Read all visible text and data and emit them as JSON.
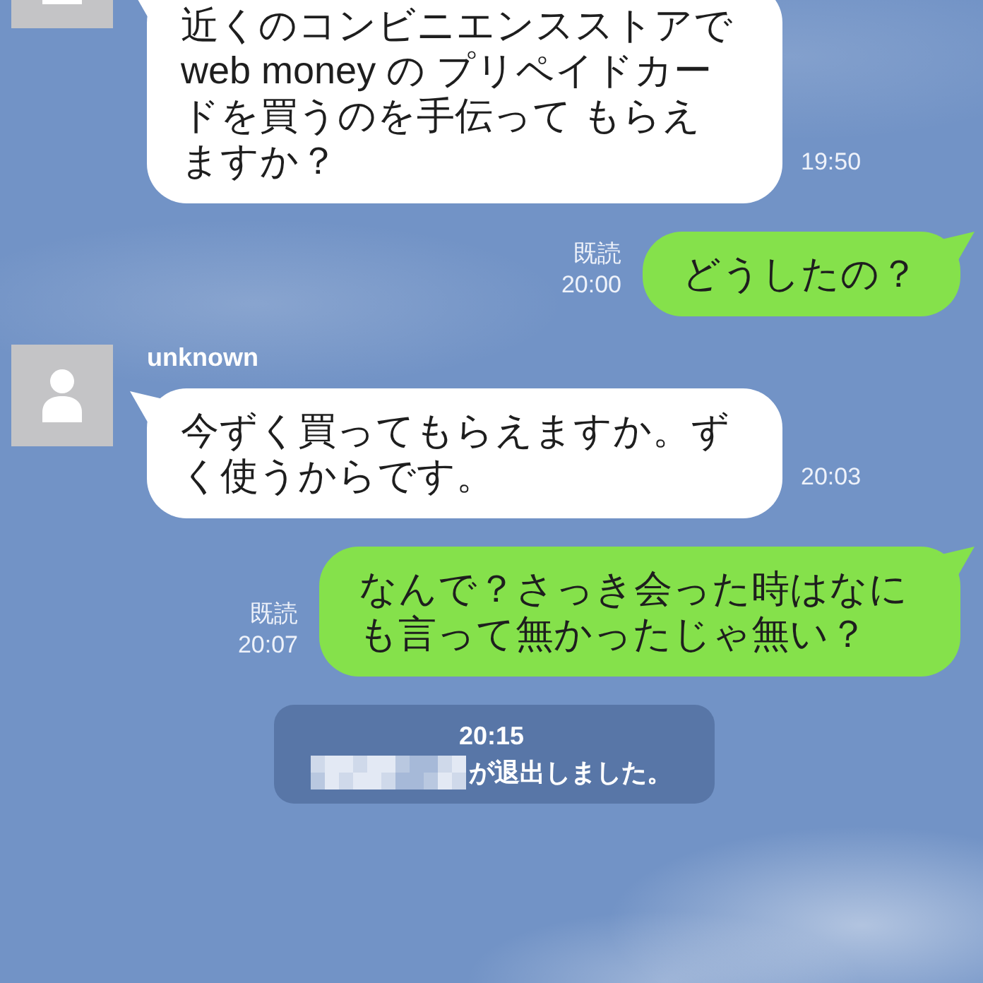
{
  "messages": [
    {
      "kind": "incoming",
      "text": "近くのコンビニエンスストアでweb money の プリペイドカードを買うのを手伝って もらえますか？",
      "time": "19:50"
    },
    {
      "kind": "outgoing",
      "read": "既読",
      "time": "20:00",
      "text": "どうしたの？"
    },
    {
      "kind": "incoming",
      "sender": "unknown",
      "text": "今ずく買ってもらえますか。ずく使うからです。",
      "time": "20:03"
    },
    {
      "kind": "outgoing",
      "read": "既読",
      "time": "20:07",
      "text": "なんで？さっき会った時はなにも言って無かったじゃ無い？"
    },
    {
      "kind": "system",
      "time": "20:15",
      "name_hidden": true,
      "text": "が退出しました。"
    }
  ]
}
